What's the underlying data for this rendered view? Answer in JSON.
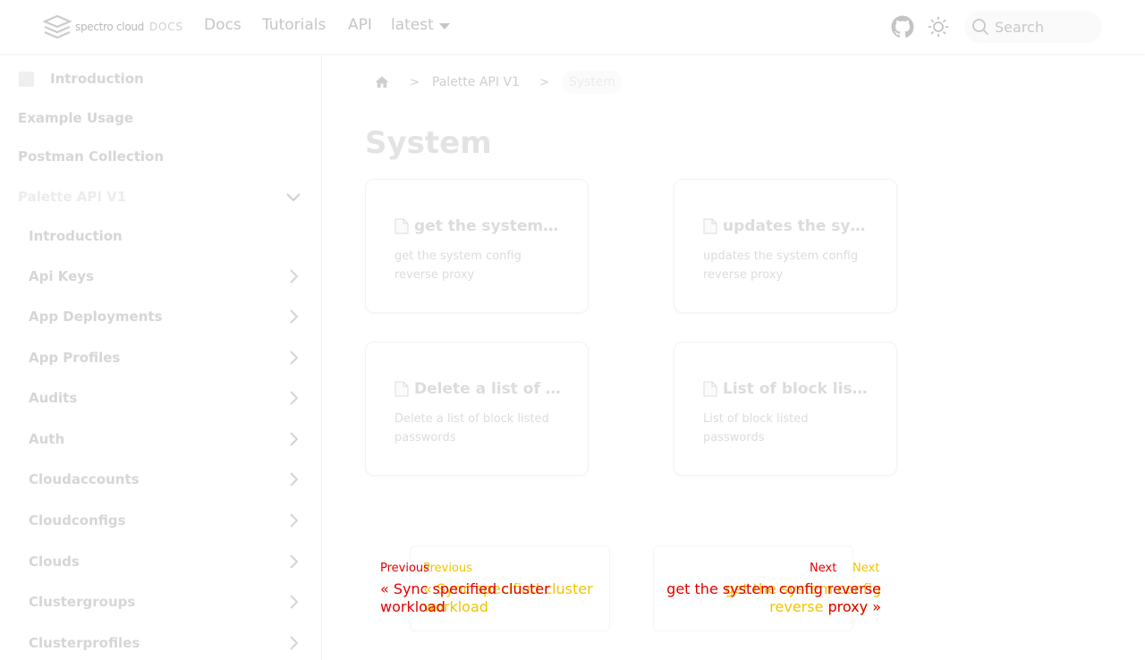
{
  "header": {
    "logo_text": "spectro cloud",
    "logo_docs": "DOCS",
    "nav": [
      "Docs",
      "Tutorials",
      "API"
    ],
    "version": "latest",
    "search_placeholder": "Search"
  },
  "sidebar": {
    "items": [
      {
        "label": "Introduction"
      },
      {
        "label": "Example Usage"
      },
      {
        "label": "Postman Collection"
      },
      {
        "label": "Palette API V1"
      },
      {
        "label": "Introduction"
      },
      {
        "label": "Api Keys"
      },
      {
        "label": "App Deployments"
      },
      {
        "label": "App Profiles"
      },
      {
        "label": "Audits"
      },
      {
        "label": "Auth"
      },
      {
        "label": "Cloudaccounts"
      },
      {
        "label": "Cloudconfigs"
      },
      {
        "label": "Clouds"
      },
      {
        "label": "Clustergroups"
      },
      {
        "label": "Clusterprofiles"
      }
    ]
  },
  "breadcrumb": {
    "items": [
      "Palette API V1",
      "System"
    ]
  },
  "page": {
    "title": "System"
  },
  "cards": [
    {
      "title": "get the system co...",
      "desc": "get the system config reverse proxy"
    },
    {
      "title": "updates the syste...",
      "desc": "updates the system config reverse proxy"
    },
    {
      "title": "Delete a list of blo...",
      "desc": "Delete a list of block listed passwords"
    },
    {
      "title": "List of block listed...",
      "desc": "List of block listed passwords"
    }
  ],
  "pagination": {
    "prev_label": "Previous",
    "prev_title": "« Sync specified cluster workload",
    "prev_title_ghost": "« Sync specified cluster workload",
    "next_label": "Next",
    "next_title": "get the system config reverse proxy »",
    "next_title_ghost": "get the system config reverse proxy »"
  },
  "colors": {
    "error_red": "#e30000",
    "warning_yellow": "#f1c400"
  }
}
